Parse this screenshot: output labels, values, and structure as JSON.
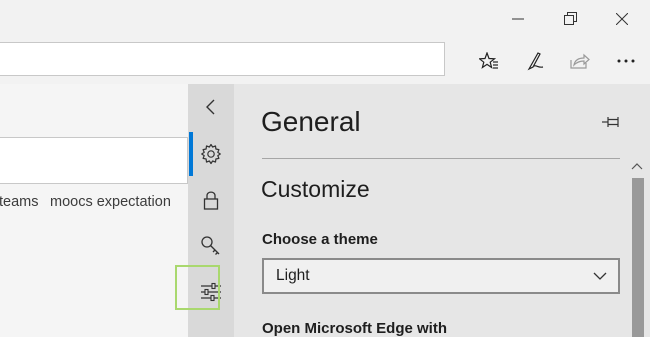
{
  "window": {
    "minimize_label": "minimize",
    "restore_label": "restore",
    "close_label": "close"
  },
  "toolbar": {
    "address_value": "",
    "icons": [
      "favorites-star-icon",
      "pen-notes-icon",
      "share-icon",
      "more-icon"
    ]
  },
  "page": {
    "suggestions": [
      "teams",
      "moocs expectation"
    ]
  },
  "rail": {
    "items": [
      "back-chevron-icon",
      "gear-icon",
      "lock-icon",
      "key-icon",
      "sliders-icon"
    ]
  },
  "settings": {
    "title": "General",
    "section": "Customize",
    "theme_label": "Choose a theme",
    "theme_value": "Light",
    "open_with_label": "Open Microsoft Edge with"
  },
  "colors": {
    "accent": "#0078d7",
    "highlight": "#a9d86e",
    "rail_bg": "#d9d9d9",
    "panel_bg": "#e6e6e6"
  }
}
